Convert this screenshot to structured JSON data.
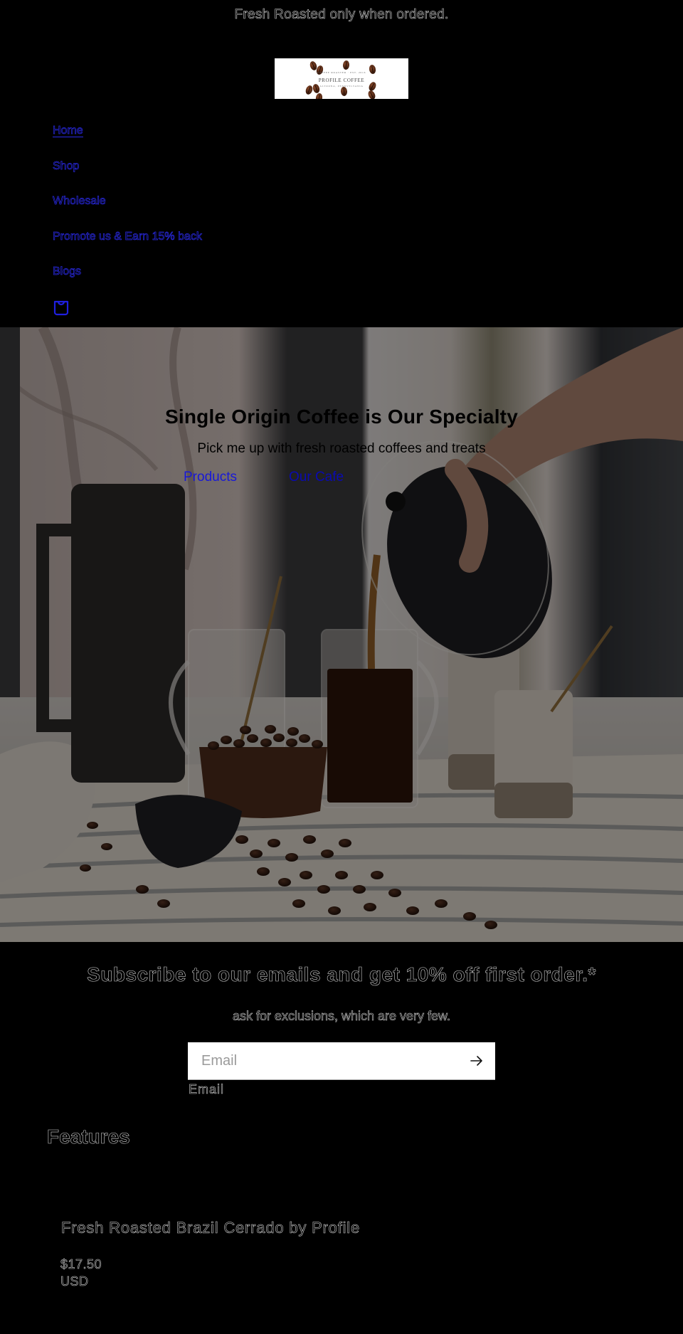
{
  "announcement": {
    "text": "Fresh Roasted only when ordered."
  },
  "header": {
    "logo": {
      "brand": "PROFILE COFFEE",
      "tagline_top": "COFFEE ROASTER · EST. 2016",
      "tagline_bottom": "ALTOONA, PENNSYLVANIA"
    },
    "nav": [
      {
        "label": "Home",
        "active": true
      },
      {
        "label": "Shop"
      },
      {
        "label": "Wholesale"
      },
      {
        "label": "Promote us & Earn 15% back"
      },
      {
        "label": "Blogs"
      }
    ],
    "cart_icon": "cart-bag-icon"
  },
  "hero": {
    "title": "Single Origin Coffee is Our Specialty",
    "subtitle": "Pick me up with fresh roasted coffees and treats",
    "buttons": [
      {
        "label": "Products"
      },
      {
        "label": "Our Cafe"
      }
    ],
    "image_description": "Hand pouring coffee from a French press into glass mugs with coffee beans on a striped cloth"
  },
  "newsletter": {
    "title": "Subscribe to our emails and get 10% off first order.*",
    "text": "ask for exclusions, which are very few.",
    "email_placeholder": "Email",
    "email_value": "",
    "email_label": "Email",
    "submit_icon": "arrow-right-icon"
  },
  "features": {
    "title": "Features",
    "products": [
      {
        "title": "Fresh Roasted Brazil Cerrado by Profile",
        "price": "$17.50",
        "currency": "USD"
      }
    ]
  },
  "colors": {
    "background": "#000000",
    "link_blue": "#2a2ae8",
    "outline_text": "#cfcfcf",
    "input_bg": "#ffffff"
  }
}
